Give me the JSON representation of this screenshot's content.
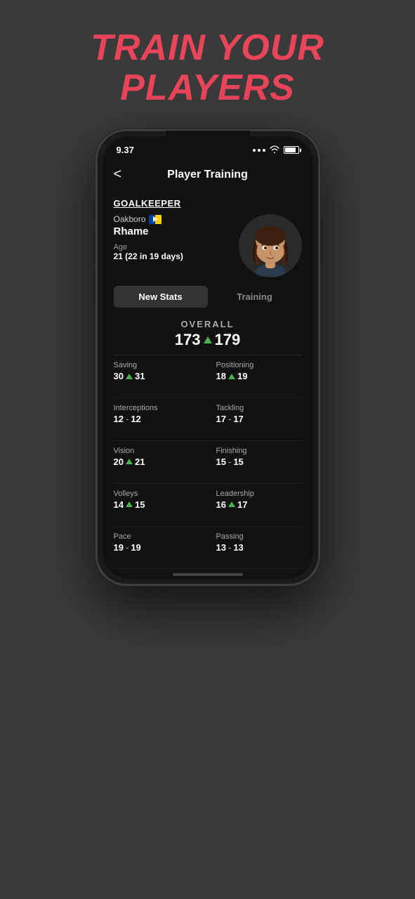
{
  "headline": {
    "line1": "TRAIN YOUR",
    "line2": "PLAYERS"
  },
  "status_bar": {
    "time": "9.37",
    "dots": [
      "•",
      "•",
      "•"
    ],
    "wifi": "wifi",
    "battery": "battery"
  },
  "nav": {
    "back_label": "<",
    "title": "Player Training"
  },
  "player": {
    "position": "GOALKEEPER",
    "club": "Oakboro",
    "name": "Rhame",
    "age_label": "Age",
    "age_value": "21 (22 in 19 days)"
  },
  "tabs": {
    "new_stats": "New Stats",
    "training": "Training"
  },
  "overall": {
    "label": "OVERALL",
    "old_value": "173",
    "new_value": "179"
  },
  "stats": [
    {
      "name": "Saving",
      "old": "30",
      "new": "31",
      "changed": true,
      "separator": ""
    },
    {
      "name": "Positioning",
      "old": "18",
      "new": "19",
      "changed": true,
      "separator": ""
    },
    {
      "name": "Interceptions",
      "old": "12",
      "new": "12",
      "changed": false,
      "separator": "-"
    },
    {
      "name": "Tackling",
      "old": "17",
      "new": "17",
      "changed": false,
      "separator": "-"
    },
    {
      "name": "Vision",
      "old": "20",
      "new": "21",
      "changed": true,
      "separator": ""
    },
    {
      "name": "Finishing",
      "old": "15",
      "new": "15",
      "changed": false,
      "separator": "-"
    },
    {
      "name": "Volleys",
      "old": "14",
      "new": "15",
      "changed": true,
      "separator": ""
    },
    {
      "name": "Leadership",
      "old": "16",
      "new": "17",
      "changed": true,
      "separator": ""
    },
    {
      "name": "Pace",
      "old": "19",
      "new": "19",
      "changed": false,
      "separator": "-"
    },
    {
      "name": "Passing",
      "old": "13",
      "new": "13",
      "changed": false,
      "separator": "-"
    }
  ]
}
